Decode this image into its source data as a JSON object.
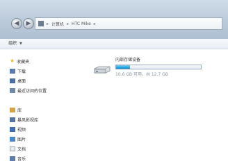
{
  "window": {
    "breadcrumb": [
      "计算机",
      "HTC Mike"
    ]
  },
  "toolbar": {
    "organize_label": "组织"
  },
  "sidebar": {
    "favorites_label": "收藏夹",
    "items_favorites": [
      "下载",
      "桌面",
      "最近访问的位置"
    ],
    "libraries_label": "库",
    "items_libraries": [
      "暴风影视库",
      "视频",
      "图片",
      "文档",
      "音乐"
    ]
  },
  "content": {
    "drive_title": "内部存储设备",
    "capacity_text": "10.6 GB 可用，共 12.7 GB",
    "used_fraction": 0.165,
    "accent_color": "#2aa7e0"
  },
  "icons": {
    "back": "back-arrow-icon",
    "forward": "forward-arrow-icon",
    "drive": "removable-drive-icon"
  }
}
